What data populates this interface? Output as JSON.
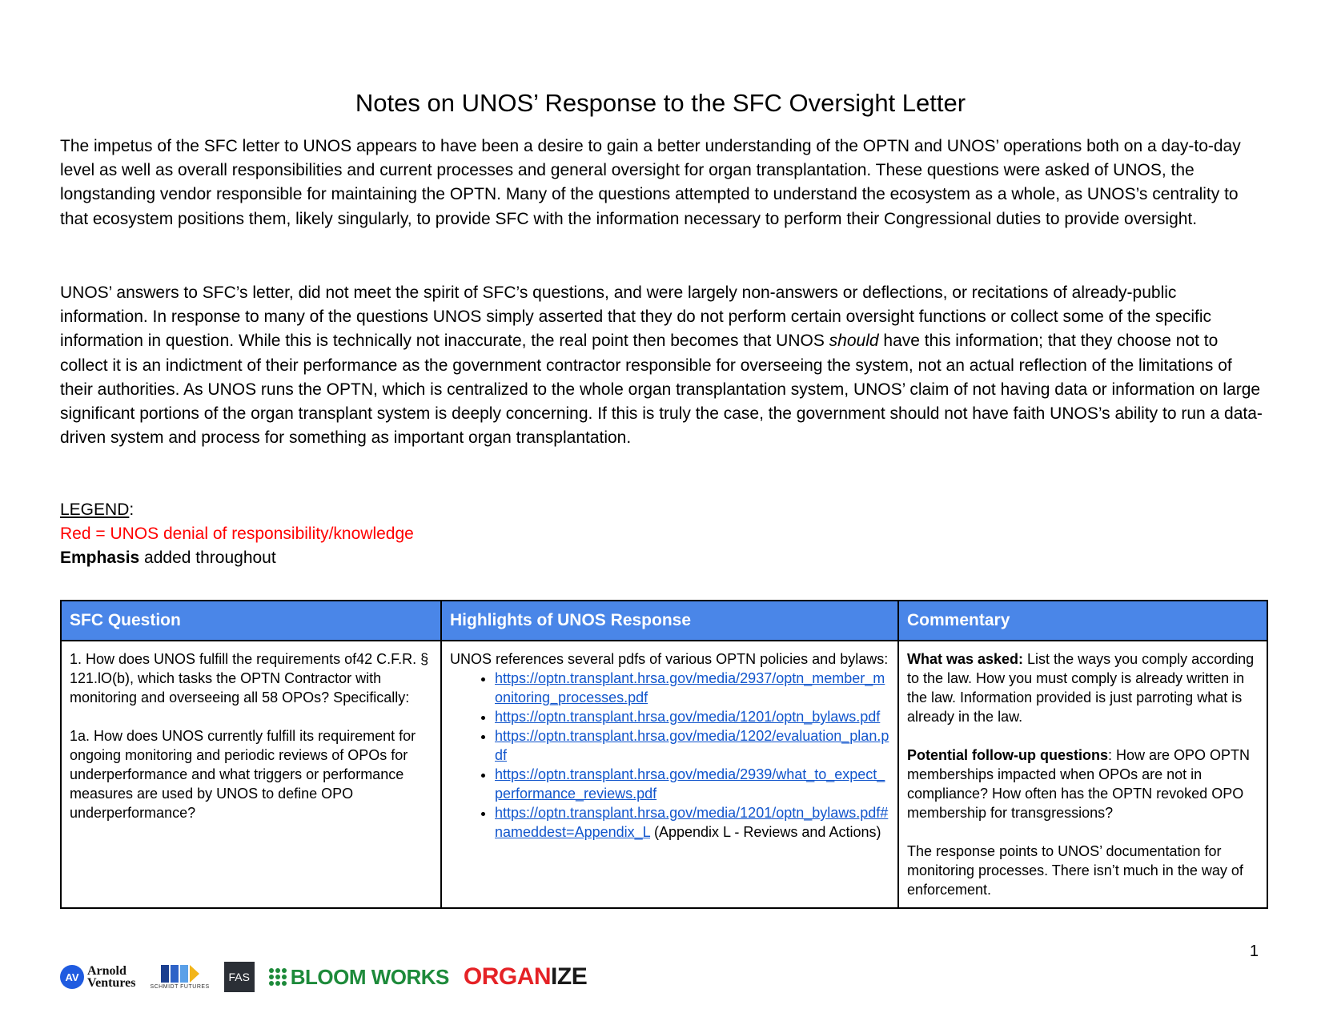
{
  "document": {
    "title": "Notes on UNOS’ Response to the SFC Oversight Letter",
    "paragraph1": "The impetus of the SFC letter to UNOS appears to have been a desire to gain a better understanding of the OPTN and UNOS’ operations both on a day-to-day level as well as overall responsibilities and current processes and general oversight for organ transplantation. These questions were asked of UNOS, the longstanding vendor responsible for maintaining the OPTN. Many of the questions attempted to understand the ecosystem as a whole, as UNOS’s centrality to that ecosystem positions them, likely singularly, to provide SFC with the information necessary to perform their Congressional duties to provide oversight.",
    "paragraph2_before": "UNOS’ answers to SFC’s letter, did not meet the spirit of SFC’s questions, and were largely non-answers or deflections, or recitations of already-public information. In response to many of the questions UNOS simply asserted that they do not perform certain oversight functions or collect some of the specific information in question. While this is technically not inaccurate, the real point then becomes that UNOS ",
    "paragraph2_italic": "should",
    "paragraph2_after": " have this information; that they choose not to collect it is an indictment of their performance as the government contractor responsible for overseeing the system, not an actual reflection of the limitations of their authorities. As UNOS runs the OPTN, which is centralized to the whole organ transplantation system, UNOS’ claim of not having data or information on large significant portions of the organ transplant system is deeply concerning. If this is truly the case, the government should not have faith UNOS’s ability to run a data-driven system and process for something as important organ transplantation.",
    "page_number": "1"
  },
  "legend": {
    "label": "LEGEND",
    "colon": ":",
    "red_line": "Red = UNOS denial of responsibility/knowledge",
    "emphasis_word": "Emphasis",
    "emphasis_rest": " added throughout"
  },
  "table": {
    "headers": [
      "SFC Question",
      "Highlights of UNOS Response",
      "Commentary"
    ],
    "row1": {
      "question_p1": "1. How does UNOS fulfill the requirements of42 C.F.R. § 121.lO(b), which tasks the OPTN Contractor with monitoring and overseeing all 58 OPOs? Specifically:",
      "question_p2": "1a. How does UNOS currently fulfill its requirement for ongoing monitoring and periodic reviews of OPOs for underperformance and what triggers or performance measures are used by UNOS to define OPO underperformance?",
      "response_intro": "UNOS references several pdfs of various OPTN policies and bylaws:",
      "links": [
        "https://optn.transplant.hrsa.gov/media/2937/optn_member_monitoring_processes.pdf",
        "https://optn.transplant.hrsa.gov/media/1201/optn_bylaws.pdf",
        "https://optn.transplant.hrsa.gov/media/1202/evaluation_plan.pdf",
        "https://optn.transplant.hrsa.gov/media/2939/what_to_expect_performance_reviews.pdf",
        "https://optn.transplant.hrsa.gov/media/1201/optn_bylaws.pdf#nameddest=Appendix_L"
      ],
      "last_link_suffix": " (Appendix L - Reviews and Actions)",
      "comment_asked_label": "What was asked:",
      "comment_asked_text": " List the ways you comply according to the law. How you must comply is already written in the law. Information provided is just parroting what is already in the law.",
      "comment_followup_label": "Potential follow-up questions",
      "comment_followup_text": ": How are OPO OPTN memberships impacted when OPOs are not in compliance? How often has the OPTN revoked OPO membership for transgressions?",
      "comment_closing": "The response points to UNOS’ documentation for monitoring processes. There isn’t much in the way of enforcement."
    }
  },
  "footer": {
    "logo_arnold_initials": "AV",
    "logo_arnold_line1": "Arnold",
    "logo_arnold_line2": "Ventures",
    "logo_schmidt": "SCHMIDT FUTURES",
    "logo_fas": "FAS",
    "logo_bloom": "BLOOM WORKS",
    "logo_organize_a": "ORGAN",
    "logo_organize_b": "IZE",
    "colors": {
      "arnold": "#1f5be0",
      "bloom": "#1d8a3a",
      "organize_red": "#e52226",
      "fas_bg": "#2b2f36",
      "header_blue": "#4a86e8",
      "link": "#1155cc",
      "legend_red": "#ff0000"
    }
  }
}
